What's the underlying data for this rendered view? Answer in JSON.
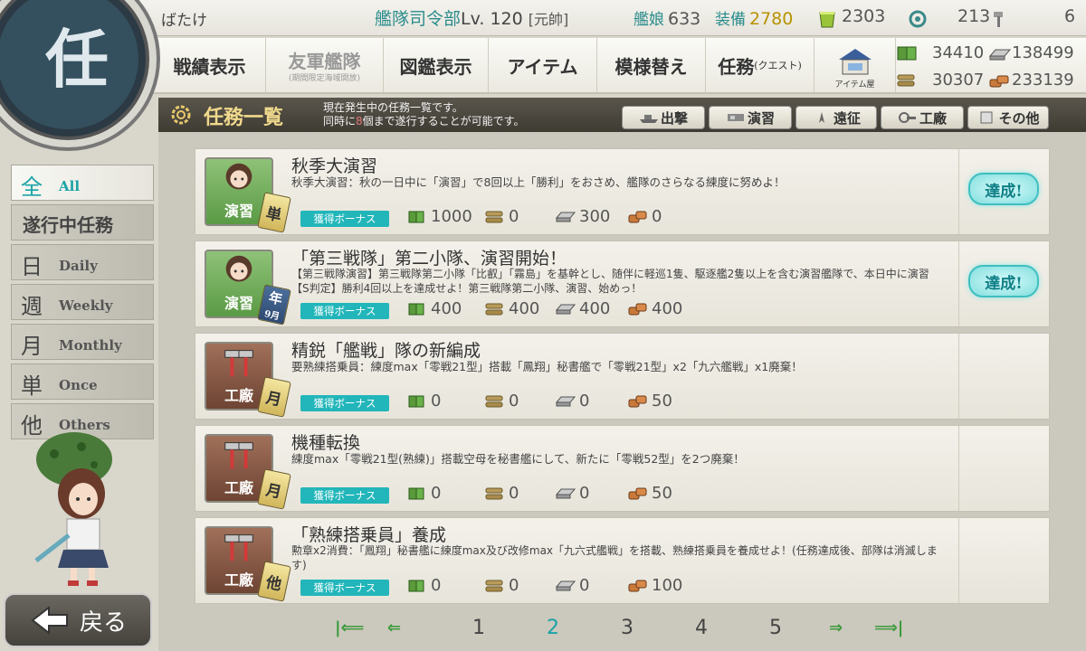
{
  "topbar": {
    "player_name": "ばたけ",
    "hq_label": "艦隊司令部",
    "hq_level": "Lv. 120",
    "rank": "[元帥]",
    "ships_label": "艦娘",
    "ships_value": "633",
    "equip_label": "装備",
    "equip_value": "2780",
    "buckets": "2303",
    "dev_mats": "213",
    "screws": "6"
  },
  "nav": {
    "record": "戦績表示",
    "friend_fleet": "友軍艦隊",
    "friend_fleet_sub": "(期間限定海域開放)",
    "library": "図鑑表示",
    "item": "アイテム",
    "decor": "模様替え",
    "quest": "任務",
    "quest_sub": "(クエスト)",
    "item_shop": "アイテム屋"
  },
  "resources": {
    "fuel": "34410",
    "steel": "138499",
    "ammo": "30307",
    "bauxite": "233139"
  },
  "header": {
    "title": "任務一覧",
    "desc_line1": "現在発生中の任務一覧です。",
    "desc_line2_a": "同時に",
    "desc_line2_num": "8",
    "desc_line2_b": "個まで遂行することが可能です。",
    "filters": [
      "出撃",
      "演習",
      "遠征",
      "工廠",
      "その他"
    ]
  },
  "sidebar": {
    "all_k": "全",
    "all_e": "All",
    "in_progress": "遂行中任務",
    "daily_k": "日",
    "daily_e": "Daily",
    "weekly_k": "週",
    "weekly_e": "Weekly",
    "monthly_k": "月",
    "monthly_e": "Monthly",
    "once_k": "単",
    "once_e": "Once",
    "others_k": "他",
    "others_e": "Others",
    "back": "戻る"
  },
  "bonus_label": "獲得ボーナス",
  "achieve_label": "達成!",
  "quests": [
    {
      "category": "演習",
      "badge": "単",
      "title": "秋季大演習",
      "desc": "秋季大演習：秋の一日中に「演習」で8回以上「勝利」をおさめ、艦隊のさらなる練度に努めよ！",
      "fuel": "1000",
      "ammo": "0",
      "steel": "300",
      "bauxite": "0",
      "achieved": true
    },
    {
      "category": "演習",
      "badge": "年",
      "badge_sub": "9月",
      "title": "「第三戦隊」第二小隊、演習開始！",
      "desc": "【第三戦隊演習】第三戦隊第二小隊「比叡」「霧島」を基幹とし、随伴に軽巡1隻、駆逐艦2隻以上を含む演習艦隊で、本日中に演習【S判定】勝利4回以上を達成せよ！第三戦隊第二小隊、演習、始めっ！",
      "fuel": "400",
      "ammo": "400",
      "steel": "400",
      "bauxite": "400",
      "achieved": true
    },
    {
      "category": "工廠",
      "badge": "月",
      "title": "精鋭「艦戦」隊の新編成",
      "desc": "要熟練搭乗員：練度max「零戦21型」搭載「鳳翔」秘書艦で「零戦21型」x2「九六艦戦」x1廃棄！",
      "fuel": "0",
      "ammo": "0",
      "steel": "0",
      "bauxite": "50",
      "achieved": false
    },
    {
      "category": "工廠",
      "badge": "月",
      "title": "機種転換",
      "desc": "練度max「零戦21型(熟練)」搭載空母を秘書艦にして、新たに「零戦52型」を2つ廃棄！",
      "fuel": "0",
      "ammo": "0",
      "steel": "0",
      "bauxite": "50",
      "achieved": false
    },
    {
      "category": "工廠",
      "badge": "他",
      "title": "「熟練搭乗員」養成",
      "desc": "勲章x2消費：「鳳翔」秘書艦に練度max及び改修max「九六式艦戦」を搭載、熟練搭乗員を養成せよ！(任務達成後、部隊は消滅します)",
      "fuel": "0",
      "ammo": "0",
      "steel": "0",
      "bauxite": "100",
      "achieved": false
    }
  ],
  "pager": {
    "pages": [
      "1",
      "2",
      "3",
      "4",
      "5"
    ],
    "current": "2"
  },
  "colors": {
    "teal": "#1aa3a6",
    "header_bg": "#4a473f",
    "gold": "#b89300"
  }
}
